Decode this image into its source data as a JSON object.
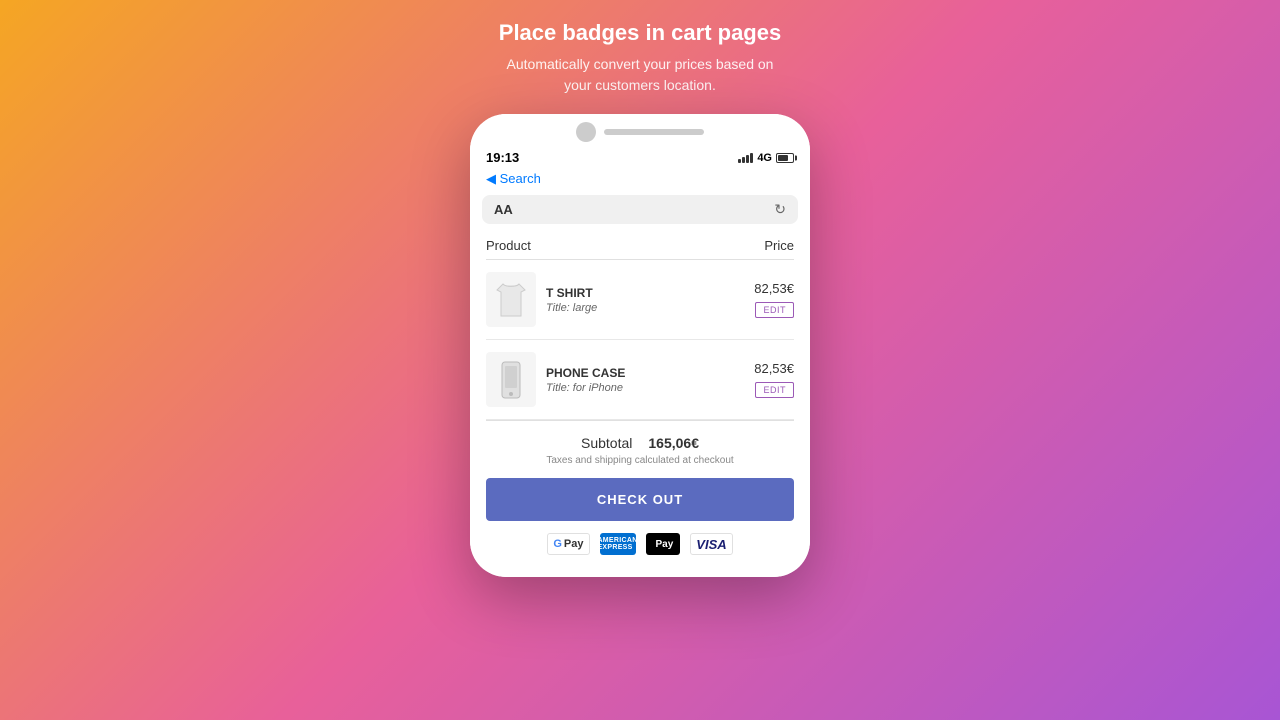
{
  "header": {
    "title": "Place badges in cart pages",
    "subtitle": "Automatically convert your prices based on\nyour customers location."
  },
  "phone": {
    "status": {
      "time": "19:13",
      "network": "4G"
    },
    "nav": {
      "back_label": "◀ Search"
    },
    "browser": {
      "aa_label": "AA"
    },
    "cart": {
      "column_product": "Product",
      "column_price": "Price",
      "items": [
        {
          "name": "T SHIRT",
          "title": "Title: large",
          "price": "82,53€",
          "edit_label": "EDIT",
          "type": "tshirt"
        },
        {
          "name": "PHONE CASE",
          "title": "Title: for iPhone",
          "price": "82,53€",
          "edit_label": "EDIT",
          "type": "phonecase"
        }
      ],
      "subtotal_label": "Subtotal",
      "subtotal_value": "165,06€",
      "tax_note": "Taxes and shipping calculated at checkout",
      "checkout_label": "CHECK OUT",
      "payment_methods": [
        "Google Pay",
        "Amex",
        "Apple Pay",
        "VISA"
      ]
    }
  }
}
